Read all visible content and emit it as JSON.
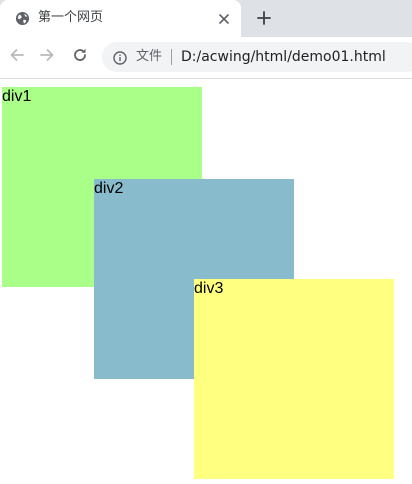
{
  "tab": {
    "title": "第一个网页",
    "icon": "globe-icon",
    "close_icon": "close-icon"
  },
  "toolbar": {
    "new_tab_icon": "plus-icon",
    "back_icon": "arrow-left-icon",
    "forward_icon": "arrow-right-icon",
    "reload_icon": "reload-icon",
    "info_icon": "info-icon",
    "chip_label": "文件",
    "url": "D:/acwing/html/demo01.html"
  },
  "page": {
    "boxes": [
      {
        "label": "div1",
        "color": "#aaff88"
      },
      {
        "label": "div2",
        "color": "#88bbcc"
      },
      {
        "label": "div3",
        "color": "#ffff80"
      }
    ]
  },
  "colors": {
    "tabstrip": "#dee1e6",
    "omnibox": "#f1f3f4"
  }
}
